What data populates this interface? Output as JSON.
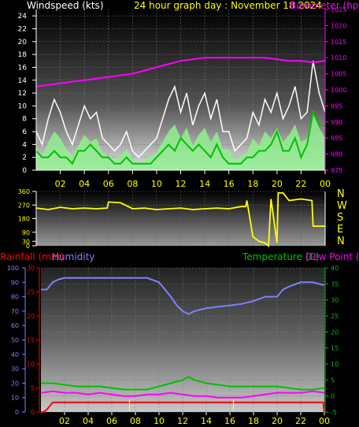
{
  "page_title": "24 hour graph day : November 18 2024",
  "colors": {
    "windspeed_label": "#ffffff",
    "title": "#ffff00",
    "barometer": "#ff00ff",
    "gust": "#ffffff",
    "avg_wind": "#00c000",
    "wind_fill": "#90ee90",
    "direction": "#ffff00",
    "rainfall": "#ff0000",
    "humidity": "#8080ff",
    "temperature": "#00c000",
    "dewpoint": "#ff00ff",
    "frame": "#ffffff"
  },
  "chart_data": [
    {
      "type": "line",
      "title": "24 hour graph day : November 18 2024",
      "x_tick_labels": [
        "02",
        "04",
        "06",
        "08",
        "10",
        "12",
        "14",
        "16",
        "18",
        "20",
        "22",
        "00"
      ],
      "x_range_hours": [
        0,
        24
      ],
      "left_axis": {
        "label": "Windspeed (kts)",
        "ticks": [
          0,
          2,
          4,
          6,
          8,
          10,
          12,
          14,
          16,
          18,
          20,
          22,
          24
        ],
        "range": [
          0,
          25
        ]
      },
      "right_axis": {
        "label": "Barometer (hpa)",
        "ticks": [
          975,
          980,
          985,
          990,
          995,
          1000,
          1005,
          1010,
          1015,
          1020,
          1025
        ],
        "range": [
          975,
          1025
        ]
      },
      "series": [
        {
          "name": "Gust",
          "axis": "left",
          "x": [
            0,
            0.5,
            1,
            1.5,
            2,
            2.5,
            3,
            3.5,
            4,
            4.5,
            5,
            5.5,
            6,
            6.5,
            7,
            7.5,
            8,
            8.5,
            9,
            9.5,
            10,
            10.5,
            11,
            11.5,
            12,
            12.5,
            13,
            13.5,
            14,
            14.5,
            15,
            15.5,
            16,
            16.5,
            17,
            17.5,
            18,
            18.5,
            19,
            19.5,
            20,
            20.5,
            21,
            21.5,
            22,
            22.5,
            23,
            23.5,
            24
          ],
          "values": [
            6,
            4,
            8,
            11,
            9,
            6,
            4,
            7,
            10,
            8,
            9,
            5,
            4,
            3,
            4,
            6,
            3,
            2,
            3,
            4,
            5,
            8,
            11,
            13,
            9,
            12,
            7,
            10,
            12,
            8,
            11,
            6,
            6,
            3,
            4,
            5,
            9,
            7,
            11,
            9,
            12,
            8,
            10,
            13,
            8,
            9,
            17,
            12,
            9
          ]
        },
        {
          "name": "Average",
          "axis": "left",
          "x": [
            0,
            0.5,
            1,
            1.5,
            2,
            2.5,
            3,
            3.5,
            4,
            4.5,
            5,
            5.5,
            6,
            6.5,
            7,
            7.5,
            8,
            8.5,
            9,
            9.5,
            10,
            10.5,
            11,
            11.5,
            12,
            12.5,
            13,
            13.5,
            14,
            14.5,
            15,
            15.5,
            16,
            16.5,
            17,
            17.5,
            18,
            18.5,
            19,
            19.5,
            20,
            20.5,
            21,
            21.5,
            22,
            22.5,
            23,
            23.5,
            24
          ],
          "values": [
            3,
            2,
            2,
            3,
            2,
            2,
            1,
            3,
            3,
            4,
            3,
            2,
            2,
            1,
            1,
            2,
            1,
            1,
            1,
            1,
            2,
            3,
            4,
            3,
            5,
            4,
            3,
            4,
            3,
            2,
            4,
            2,
            1,
            1,
            1,
            2,
            2,
            3,
            3,
            4,
            6,
            3,
            3,
            5,
            2,
            4,
            9,
            7,
            7
          ]
        },
        {
          "name": "Barometer",
          "axis": "right",
          "x": [
            0,
            1,
            2,
            3,
            4,
            5,
            6,
            7,
            8,
            9,
            10,
            11,
            12,
            13,
            14,
            15,
            16,
            17,
            18,
            19,
            20,
            21,
            22,
            23,
            24
          ],
          "values": [
            1001,
            1001.5,
            1002,
            1002.5,
            1003,
            1003.5,
            1004,
            1004.5,
            1005,
            1006,
            1007,
            1008,
            1009,
            1009.5,
            1010,
            1010,
            1010,
            1010,
            1010,
            1010,
            1009.5,
            1009,
            1009,
            1008.5,
            1009
          ]
        }
      ]
    },
    {
      "type": "line",
      "title": "Wind direction",
      "x_range_hours": [
        0,
        24
      ],
      "left_axis": {
        "ticks": [
          0,
          30,
          90,
          180,
          270,
          360
        ],
        "range": [
          0,
          360
        ]
      },
      "right_axis": {
        "ticks": [
          "N",
          "W",
          "S",
          "E",
          "N"
        ]
      },
      "series": [
        {
          "name": "Direction",
          "x": [
            0,
            1,
            2,
            3,
            4,
            5,
            5.9,
            6,
            7,
            7.9,
            8,
            9,
            10,
            11,
            12,
            13,
            14,
            15,
            16,
            17,
            17.4,
            17.5,
            18,
            18.5,
            19,
            19.3,
            19.5,
            20,
            20.1,
            20.5,
            21,
            22,
            22.9,
            23,
            24
          ],
          "values": [
            250,
            240,
            255,
            245,
            250,
            245,
            250,
            290,
            285,
            250,
            245,
            250,
            240,
            245,
            250,
            240,
            245,
            250,
            245,
            260,
            260,
            300,
            60,
            30,
            20,
            0,
            310,
            20,
            350,
            350,
            300,
            310,
            300,
            130,
            130
          ]
        }
      ]
    },
    {
      "type": "line",
      "title": "Rainfall / Humidity / Temperature / Dew Point",
      "x_tick_labels": [
        "02",
        "04",
        "06",
        "08",
        "10",
        "12",
        "14",
        "16",
        "18",
        "20",
        "22",
        "00"
      ],
      "x_range_hours": [
        0,
        24
      ],
      "axes": [
        {
          "label": "Rainfall (mm)",
          "ticks": [
            0,
            5,
            10,
            15,
            20,
            25,
            30
          ],
          "range": [
            0,
            30
          ]
        },
        {
          "label": "Humidity",
          "ticks": [
            0,
            10,
            20,
            30,
            40,
            50,
            60,
            70,
            80,
            90,
            100
          ],
          "range": [
            0,
            100
          ]
        },
        {
          "label": "Temperature (C)",
          "ticks": [
            -5,
            0,
            5,
            10,
            15,
            20,
            25,
            30,
            35,
            40
          ],
          "range": [
            -5,
            40
          ]
        },
        {
          "label": "Dew Point (C)"
        }
      ],
      "series": [
        {
          "name": "Humidity",
          "axis": "Humidity",
          "x": [
            0,
            0.5,
            1,
            1.5,
            2,
            3,
            4,
            5,
            6,
            7,
            8,
            9,
            10,
            10.5,
            11,
            11.5,
            12,
            12.5,
            13,
            14,
            15,
            16,
            17,
            18,
            19,
            20,
            20.5,
            21,
            22,
            23,
            24
          ],
          "values": [
            85,
            85,
            90,
            92,
            93,
            93,
            93,
            93,
            93,
            93,
            93,
            93,
            90,
            85,
            80,
            74,
            70,
            68,
            70,
            72,
            73,
            74,
            75,
            77,
            80,
            80,
            85,
            87,
            90,
            90,
            88
          ]
        },
        {
          "name": "Temperature",
          "axis": "Temperature (C)",
          "x": [
            0,
            1,
            2,
            3,
            4,
            5,
            6,
            7,
            8,
            9,
            10,
            11,
            12,
            12.5,
            13,
            14,
            15,
            16,
            17,
            18,
            19,
            20,
            21,
            22,
            23,
            24
          ],
          "values": [
            4,
            4,
            3.5,
            3,
            3,
            3,
            2.5,
            2,
            2,
            2,
            3,
            4,
            5,
            6,
            5,
            4,
            3.5,
            3,
            3,
            3,
            3,
            3,
            2.5,
            2,
            2,
            2.5
          ]
        },
        {
          "name": "Dew Point",
          "axis": "Temperature (C)",
          "x": [
            0,
            1,
            2,
            3,
            4,
            5,
            6,
            7,
            8,
            9,
            10,
            11,
            12,
            13,
            14,
            15,
            16,
            17,
            18,
            19,
            20,
            21,
            22,
            23,
            24
          ],
          "values": [
            1,
            1.5,
            1,
            1,
            0.5,
            1,
            0.5,
            0,
            0,
            0.5,
            0.5,
            1,
            0.5,
            0,
            0,
            -0.5,
            -0.5,
            -0.5,
            0,
            0.5,
            1,
            1,
            1,
            1.5,
            1
          ]
        },
        {
          "name": "Rainfall",
          "axis": "Rainfall (mm)",
          "x": [
            0,
            0.2,
            0.5,
            1,
            2,
            4,
            6,
            8,
            10,
            12,
            14,
            16,
            18,
            20,
            22,
            23.9,
            24
          ],
          "values": [
            0,
            0,
            0.5,
            2,
            2,
            2,
            2,
            2,
            2,
            2,
            2,
            2,
            2,
            2,
            2,
            2,
            0
          ]
        }
      ],
      "markers_hours": [
        7.5,
        16.3
      ]
    }
  ]
}
